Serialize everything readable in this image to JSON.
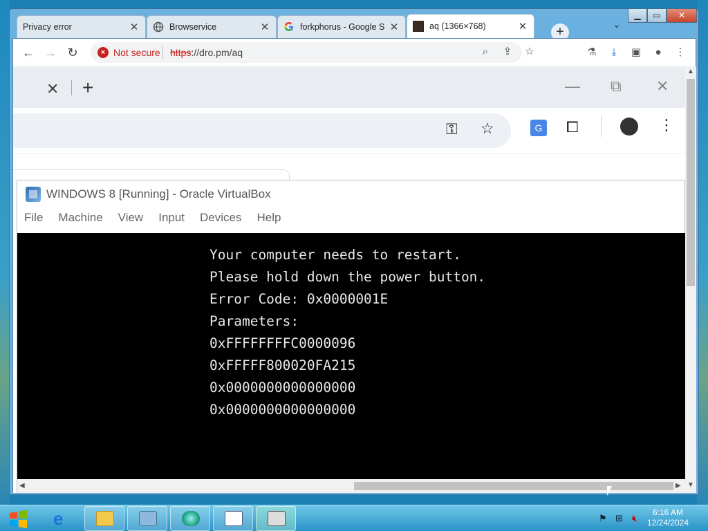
{
  "browser": {
    "tabs": [
      {
        "title": "Privacy error",
        "favicon": "none"
      },
      {
        "title": "Browservice",
        "favicon": "globe-icon"
      },
      {
        "title": "forkphorus - Google S",
        "favicon": "google-icon"
      },
      {
        "title": "aq (1366×768)",
        "favicon": "image-icon"
      }
    ],
    "new_tab": "+",
    "close_glyph": "✕",
    "window_buttons": {
      "minimize": "▁",
      "restore": "▭",
      "close": "✕"
    },
    "security_text": "Not secure",
    "url_scheme": "https",
    "url_rest": "://dro.pm/aq",
    "toolbar_icons": [
      "zoom-icon",
      "share-icon",
      "star-icon",
      "flask-icon",
      "download-icon",
      "sidepanel-icon",
      "profile-icon",
      "menu-icon"
    ]
  },
  "inner_browser": {
    "close_glyph": "✕",
    "plus_glyph": "+",
    "icons": [
      "key-icon",
      "star-icon",
      "translate-icon",
      "extension-icon",
      "profile-icon",
      "menu-icon"
    ]
  },
  "vbox": {
    "title": "WINDOWS 8 [Running] - Oracle VirtualBox",
    "menu": [
      "File",
      "Machine",
      "View",
      "Input",
      "Devices",
      "Help"
    ],
    "screen_lines": [
      "Your computer needs to restart.",
      "Please hold down the power button.",
      "Error Code: 0x0000001E",
      "Parameters:",
      "0xFFFFFFFFC0000096",
      "0xFFFFF800020FA215",
      "0x0000000000000000",
      "0x0000000000000000"
    ]
  },
  "taskbar": {
    "clock_time": "6:16 AM",
    "clock_date": "12/24/2024",
    "apps": [
      "ie-icon",
      "explorer-icon",
      "control-panel-icon",
      "network-icon",
      "notes-icon",
      "device-icon"
    ]
  },
  "colors": {
    "desktop": "#1b7fb3",
    "taskbar": "#2a93c7",
    "error_red": "#c5221f",
    "vm_background": "#000000"
  }
}
